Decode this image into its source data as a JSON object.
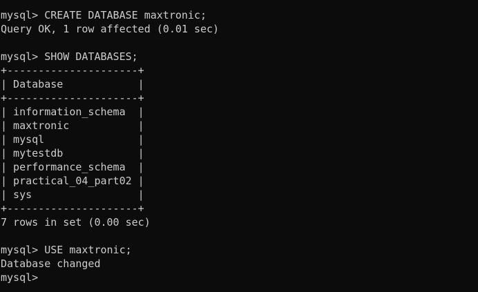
{
  "terminal": {
    "lines": [
      "mysql> CREATE DATABASE maxtronic;",
      "Query OK, 1 row affected (0.01 sec)",
      "",
      "mysql> SHOW DATABASES;",
      "+---------------------+",
      "| Database            |",
      "+---------------------+",
      "| information_schema  |",
      "| maxtronic           |",
      "| mysql               |",
      "| mytestdb            |",
      "| performance_schema  |",
      "| practical_04_part02 |",
      "| sys                 |",
      "+---------------------+",
      "7 rows in set (0.00 sec)",
      "",
      "mysql> USE maxtronic;",
      "Database changed",
      "mysql> "
    ]
  }
}
